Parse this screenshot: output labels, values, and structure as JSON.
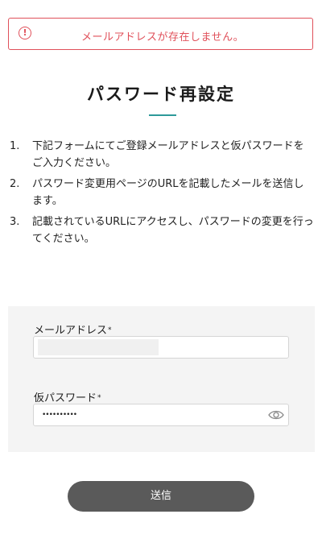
{
  "alert": {
    "icon": "exclamation-circle-icon",
    "message": "メールアドレスが存在しません。",
    "color": "#e0505a"
  },
  "page": {
    "title": "パスワード再設定",
    "accent_color": "#2d9a9a"
  },
  "instructions": [
    {
      "num": "1.",
      "text": "下記フォームにてご登録メールアドレスと仮パスワードをご入力ください。"
    },
    {
      "num": "2.",
      "text": "パスワード変更用ページのURLを記載したメールを送信します。"
    },
    {
      "num": "3.",
      "text": "記載されているURLにアクセスし、パスワードの変更を行ってください。"
    }
  ],
  "form": {
    "email": {
      "label": "メールアドレス",
      "required_mark": "*",
      "value": ""
    },
    "temp_password": {
      "label": "仮パスワード",
      "required_mark": "*",
      "value_masked": "••••••••••",
      "toggle_icon": "eye-icon"
    }
  },
  "submit": {
    "label": "送信",
    "color": "#5a5a5a"
  }
}
